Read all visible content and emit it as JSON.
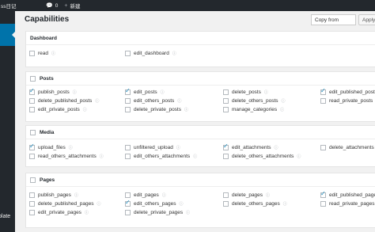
{
  "adminbar": {
    "site": "ss日记",
    "comments_count": "0",
    "new_label": "新建"
  },
  "sidebar": {
    "bottom_label": "plate"
  },
  "header": {
    "title": "Capabilities",
    "copy_from": "Copy from",
    "apply": "Apply"
  },
  "info_glyph": "ⓘ",
  "groups": {
    "dashboard": {
      "title": "Dashboard",
      "caps": [
        {
          "label": "read",
          "checked": false
        },
        {
          "label": "edit_dashboard",
          "checked": false
        }
      ]
    },
    "posts": {
      "title": "Posts",
      "caps": [
        {
          "label": "publish_posts",
          "checked": true
        },
        {
          "label": "edit_posts",
          "checked": true
        },
        {
          "label": "delete_posts",
          "checked": false
        },
        {
          "label": "edit_published_posts",
          "checked": true
        },
        {
          "label": "delete_published_posts",
          "checked": false
        },
        {
          "label": "edit_others_posts",
          "checked": false
        },
        {
          "label": "delete_others_posts",
          "checked": false
        },
        {
          "label": "read_private_posts",
          "checked": false
        },
        {
          "label": "edit_private_posts",
          "checked": false
        },
        {
          "label": "delete_private_posts",
          "checked": false
        },
        {
          "label": "manage_categories",
          "checked": false
        }
      ]
    },
    "media": {
      "title": "Media",
      "caps": [
        {
          "label": "upload_files",
          "checked": true
        },
        {
          "label": "unfiltered_upload",
          "checked": false
        },
        {
          "label": "edit_attachments",
          "checked": true
        },
        {
          "label": "delete_attachments",
          "checked": false
        },
        {
          "label": "read_others_attachments",
          "checked": false
        },
        {
          "label": "edit_others_attachments",
          "checked": false
        },
        {
          "label": "delete_others_attachments",
          "checked": false
        }
      ]
    },
    "pages": {
      "title": "Pages",
      "caps": [
        {
          "label": "publish_pages",
          "checked": false
        },
        {
          "label": "edit_pages",
          "checked": false
        },
        {
          "label": "delete_pages",
          "checked": false
        },
        {
          "label": "edit_published_pages",
          "checked": true
        },
        {
          "label": "delete_published_pages",
          "checked": false
        },
        {
          "label": "edit_others_pages",
          "checked": true
        },
        {
          "label": "delete_others_pages",
          "checked": false
        },
        {
          "label": "read_private_pages",
          "checked": false
        },
        {
          "label": "edit_private_pages",
          "checked": false
        },
        {
          "label": "delete_private_pages",
          "checked": false
        }
      ]
    }
  }
}
